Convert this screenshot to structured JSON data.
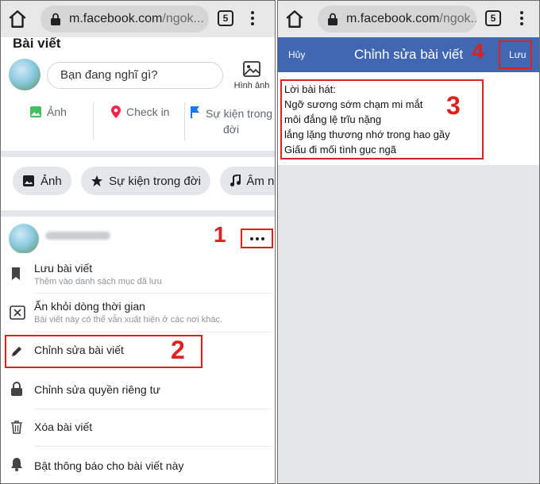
{
  "browser": {
    "url_host": "m.facebook.com",
    "url_path": "/ngok...",
    "tab_count": "5"
  },
  "left": {
    "page_title": "Bài viết",
    "composer_placeholder": "Bạn đang nghĩ gì?",
    "photo_label": "Hình ảnh",
    "actions": {
      "photo": "Ảnh",
      "checkin": "Check in",
      "life_event_1": "Sự kiện trong",
      "life_event_2": "đời"
    },
    "chips": {
      "photo": "Ảnh",
      "life_event": "Sự kiện trong đời",
      "music": "Âm nhạc"
    },
    "menu": {
      "save_label": "Lưu bài viết",
      "save_sub": "Thêm vào danh sách mục đã lưu",
      "hide_label": "Ẩn khỏi dòng thời gian",
      "hide_sub": "Bài viết này có thể vẫn xuất hiện ở các nơi khác.",
      "edit_label": "Chỉnh sửa bài viết",
      "privacy_label": "Chỉnh sửa quyền riêng tư",
      "delete_label": "Xóa bài viết",
      "notify_label": "Bật thông báo cho bài viết này"
    },
    "steps": {
      "one": "1",
      "two": "2"
    }
  },
  "right": {
    "cancel_label": "Hủy",
    "title": "Chỉnh sửa bài viết",
    "save_label": "Lưu",
    "lines": [
      "Lời bài hát:",
      "Ngỡ sương sớm chạm mi mắt",
      "môi đắng lệ trĩu nặng",
      "lắng lặng thương nhớ trong hao gầy",
      "Giấu đi mối tình gục ngã"
    ],
    "steps": {
      "three": "3",
      "four": "4"
    }
  },
  "colors": {
    "fb_blue": "#4267b2",
    "annotation_red": "#e0201f",
    "chrome_gray": "#e8e8e8"
  }
}
